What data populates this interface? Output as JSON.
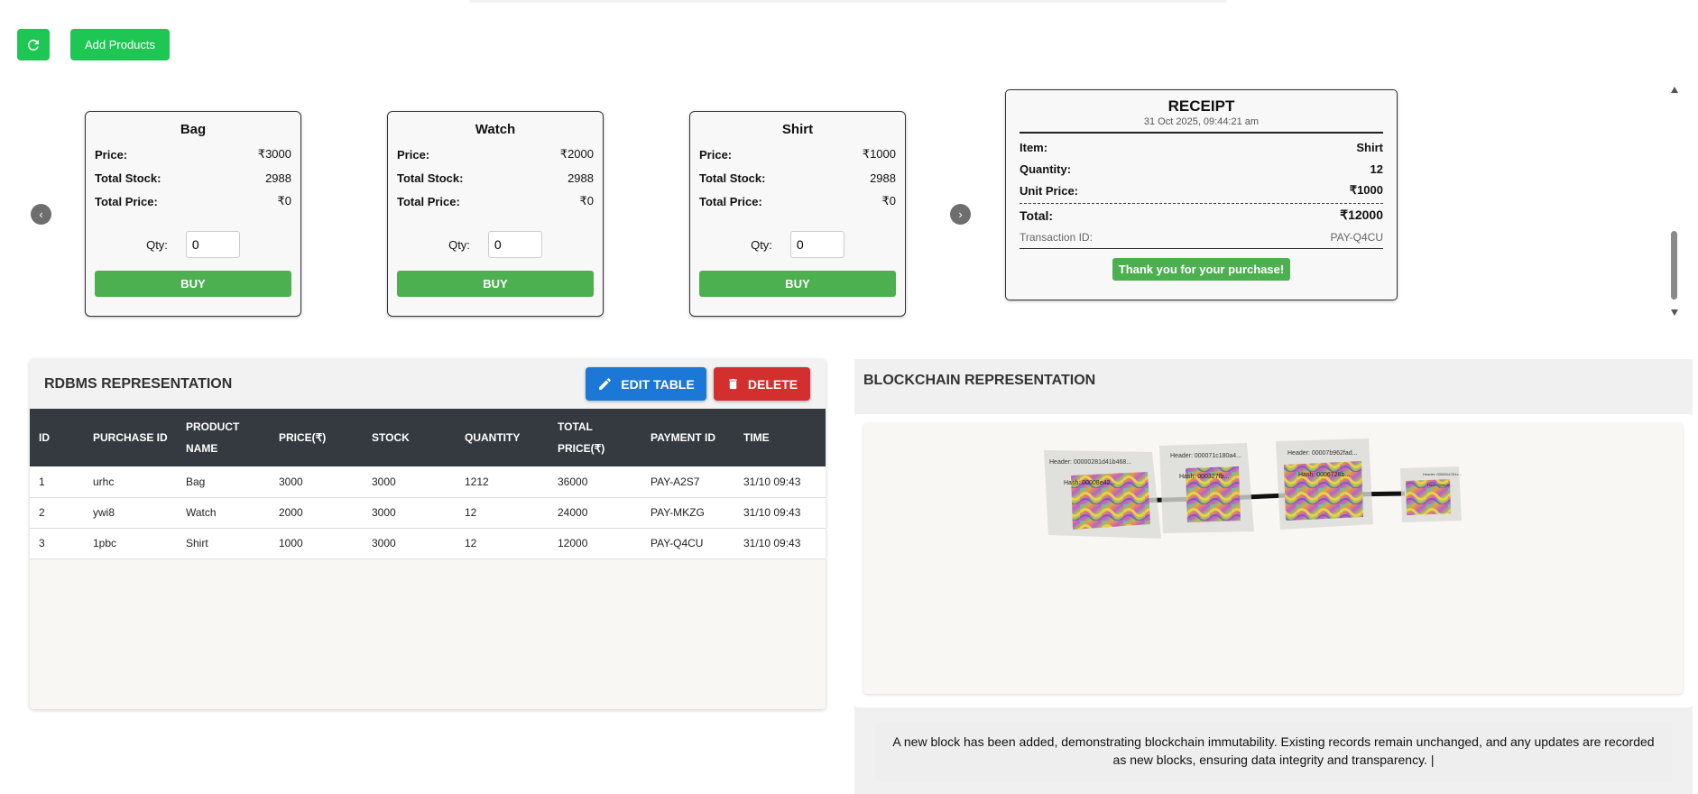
{
  "toolbar": {
    "refresh_icon": "refresh-icon",
    "add_products_label": "Add Products",
    "accent_color": "#1ec653"
  },
  "carousel": {
    "prev_glyph": "‹",
    "next_glyph": "›",
    "products": [
      {
        "name": "Bag",
        "price_label": "Price:",
        "price": "₹3000",
        "stock_label": "Total Stock:",
        "stock": "2988",
        "total_label": "Total Price:",
        "total": "₹0",
        "qty_label": "Qty:",
        "qty": "0",
        "buy_label": "BUY"
      },
      {
        "name": "Watch",
        "price_label": "Price:",
        "price": "₹2000",
        "stock_label": "Total Stock:",
        "stock": "2988",
        "total_label": "Total Price:",
        "total": "₹0",
        "qty_label": "Qty:",
        "qty": "0",
        "buy_label": "BUY"
      },
      {
        "name": "Shirt",
        "price_label": "Price:",
        "price": "₹1000",
        "stock_label": "Total Stock:",
        "stock": "2988",
        "total_label": "Total Price:",
        "total": "₹0",
        "qty_label": "Qty:",
        "qty": "0",
        "buy_label": "BUY"
      }
    ]
  },
  "receipt": {
    "title": "RECEIPT",
    "date": "31 Oct 2025, 09:44:21 am",
    "item_label": "Item:",
    "item": "Shirt",
    "quantity_label": "Quantity:",
    "quantity": "12",
    "unit_price_label": "Unit Price:",
    "unit_price": "₹1000",
    "total_label": "Total:",
    "total": "₹12000",
    "txn_label": "Transaction ID:",
    "txn": "PAY-Q4CU",
    "thanks": "Thank you for your purchase!"
  },
  "rdbms": {
    "title": "RDBMS REPRESENTATION",
    "edit_label": "EDIT TABLE",
    "delete_label": "DELETE",
    "columns": [
      "ID",
      "PURCHASE ID",
      "PRODUCT NAME",
      "PRICE(₹)",
      "STOCK",
      "QUANTITY",
      "TOTAL PRICE(₹)",
      "PAYMENT ID",
      "TIME"
    ],
    "rows": [
      [
        "1",
        "urhc",
        "Bag",
        "3000",
        "3000",
        "1212",
        "36000",
        "PAY-A2S7",
        "31/10 09:43"
      ],
      [
        "2",
        "ywi8",
        "Watch",
        "2000",
        "3000",
        "12",
        "24000",
        "PAY-MKZG",
        "31/10 09:43"
      ],
      [
        "3",
        "1pbc",
        "Shirt",
        "1000",
        "3000",
        "12",
        "12000",
        "PAY-Q4CU",
        "31/10 09:43"
      ]
    ]
  },
  "blockchain": {
    "title": "BLOCKCHAIN REPRESENTATION",
    "blocks": [
      {
        "header": "Header: 00000281d41b468...",
        "hash": "Hash: 00008e42..."
      },
      {
        "header": "Header: 000071c180a4...",
        "hash": "Hash: 000327fb..."
      },
      {
        "header": "Header: 00007b962fad...",
        "hash": "Hash: 0006728b..."
      },
      {
        "header": "Header: 00000b1761c...",
        "hash": "Hash: 000b3c..."
      }
    ],
    "message": "A new block has been added, demonstrating blockchain immutability. Existing records remain unchanged, and any updates are recorded as new blocks, ensuring data integrity and transparency. |"
  }
}
